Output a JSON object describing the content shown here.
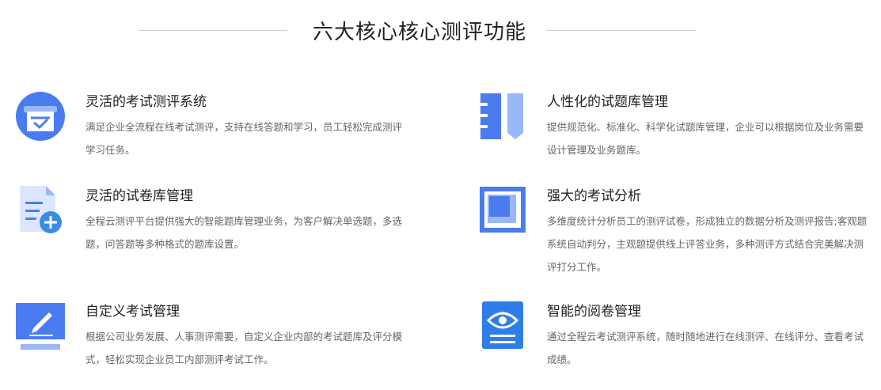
{
  "header": {
    "title": "六大核心核心测评功能"
  },
  "features": [
    {
      "title": "灵活的考试测评系统",
      "desc": "满足企业全流程在线考试测评，支持在线答题和学习，员工轻松完成测评学习任务。",
      "icon": "exam-cup-icon"
    },
    {
      "title": "灵活的试卷库管理",
      "desc": "全程云测评平台提供强大的智能题库管理业务，为客户解决单选题，多选题，问答题等多种格式的题库设置。",
      "icon": "add-document-icon"
    },
    {
      "title": "自定义考试管理",
      "desc": "根据公司业务发展、人事测评需要，自定义企业内部的考试题库及评分模式，轻松实现企业员工内部测评考试工作。",
      "icon": "edit-screen-icon"
    },
    {
      "title": "人性化的试题库管理",
      "desc": "提供规范化、标准化、科学化试题库管理，企业可以根据岗位及业务需要设计管理及业务题库。",
      "icon": "bookmark-icon"
    },
    {
      "title": "强大的考试分析",
      "desc": "多维度统计分析员工的测评试卷，形成独立的数据分析及测评报告;客观题系统自动判分，主观题提供线上评答业务，多种测评方式结合完美解决测评打分工作。",
      "icon": "layers-icon"
    },
    {
      "title": "智能的阅卷管理",
      "desc": "通过全程云考试测评系统，随时随地进行在线测评、在线评分、查看考试成绩。",
      "icon": "eye-document-icon"
    }
  ],
  "colors": {
    "primary": "#4a7cf0",
    "light": "#9ab8f8",
    "pale": "#dce7fd"
  }
}
